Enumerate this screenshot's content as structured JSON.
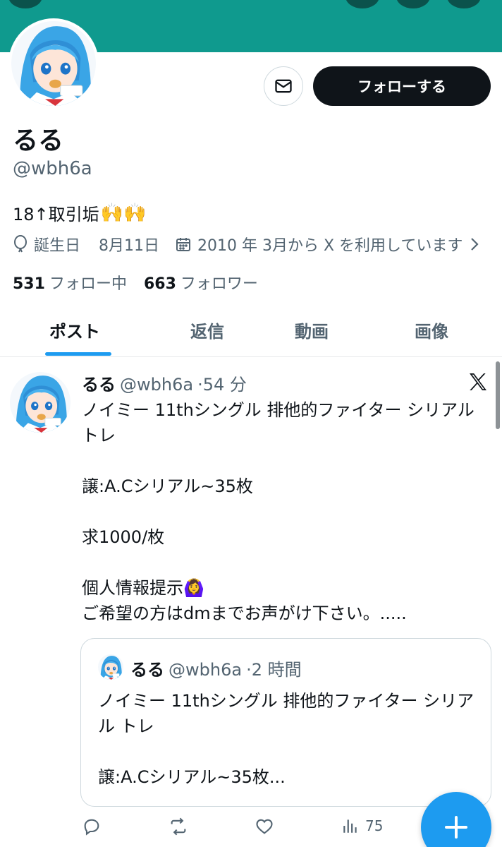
{
  "profile": {
    "display_name": "るる",
    "handle": "@wbh6a",
    "bio_text": "18↑取引垢",
    "bio_emoji": "🙌🙌",
    "birthday_label": "誕生日",
    "birthday_date": "8月11日",
    "joined": "2010 年 3月から X を利用しています",
    "following_count": "531",
    "following_label": "フォロー中",
    "followers_count": "663",
    "followers_label": "フォロワー",
    "follow_button": "フォローする"
  },
  "tabs": [
    "ポスト",
    "返信",
    "動画",
    "画像"
  ],
  "post": {
    "name": "るる",
    "handle": "@wbh6a",
    "time": "·54 分",
    "text": "ノイミー 11thシングル 排他的ファイター シリアル トレ\n\n譲:A.Cシリアル~35枚\n\n求1000/枚\n\n個人情報提示🙆‍♀️\nご希望の方はdmまでお声がけ下さい。.....",
    "quote": {
      "name": "るる",
      "handle": "@wbh6a",
      "time": "·2 時間",
      "text": "ノイミー 11thシングル 排他的ファイター シリアル トレ\n\n譲:A.Cシリアル~35枚..."
    },
    "views": "75"
  },
  "icons": {
    "dm": "mail-icon",
    "location": "balloon-icon",
    "calendar": "calendar-icon",
    "chevron": "chevron-right-icon",
    "x": "x-logo-icon",
    "reply": "reply-icon",
    "repost": "repost-icon",
    "like": "heart-icon",
    "views": "views-icon",
    "compose": "plus-icon"
  },
  "colors": {
    "banner": "#0f9a8e",
    "accent": "#1d9bf0",
    "text": "#0f1419",
    "secondary": "#536471"
  }
}
